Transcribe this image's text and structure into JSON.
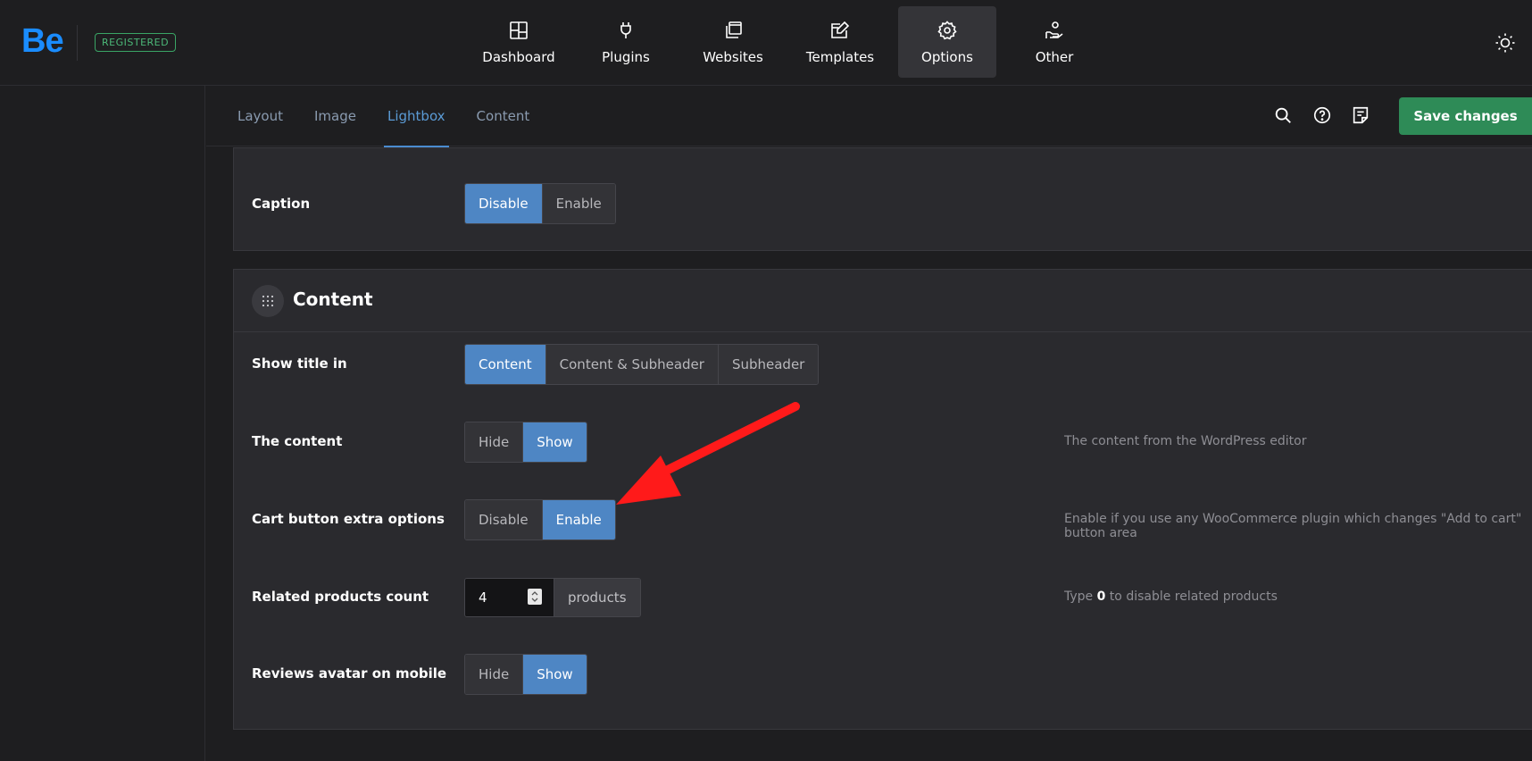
{
  "header": {
    "logo": "Be",
    "badge": "REGISTERED",
    "nav": [
      {
        "label": "Dashboard",
        "icon": "dashboard-icon"
      },
      {
        "label": "Plugins",
        "icon": "plug-icon"
      },
      {
        "label": "Websites",
        "icon": "websites-icon"
      },
      {
        "label": "Templates",
        "icon": "templates-icon"
      },
      {
        "label": "Options",
        "icon": "gear-icon",
        "active": true
      },
      {
        "label": "Other",
        "icon": "hand-heart-icon"
      }
    ],
    "theme_icon": "sun-icon"
  },
  "subbar": {
    "tabs": [
      {
        "label": "Layout"
      },
      {
        "label": "Image"
      },
      {
        "label": "Lightbox",
        "active": true
      },
      {
        "label": "Content"
      }
    ],
    "save_label": "Save changes",
    "icons": [
      "search-icon",
      "help-icon",
      "notes-icon"
    ]
  },
  "caption_panel": {
    "label": "Caption",
    "options": [
      "Disable",
      "Enable"
    ],
    "selected": "Disable"
  },
  "content_section": {
    "title": "Content",
    "rows": {
      "show_title": {
        "label": "Show title in",
        "options": [
          "Content",
          "Content & Subheader",
          "Subheader"
        ],
        "selected": "Content"
      },
      "the_content": {
        "label": "The content",
        "options": [
          "Hide",
          "Show"
        ],
        "selected": "Show",
        "description": "The content from the WordPress editor"
      },
      "cart_button": {
        "label": "Cart button extra options",
        "options": [
          "Disable",
          "Enable"
        ],
        "selected": "Enable",
        "description": "Enable if you use any WooCommerce plugin which changes \"Add to cart\" button area"
      },
      "related": {
        "label": "Related products count",
        "value": "4",
        "suffix": "products",
        "description_pre": "Type ",
        "description_bold": "0",
        "description_post": " to disable related products"
      },
      "reviews_avatar": {
        "label": "Reviews avatar on mobile",
        "options": [
          "Hide",
          "Show"
        ],
        "selected": "Show"
      }
    }
  },
  "colors": {
    "accent": "#4e86c4",
    "save": "#2e8b57",
    "annotation_arrow": "#ff1a1a"
  }
}
